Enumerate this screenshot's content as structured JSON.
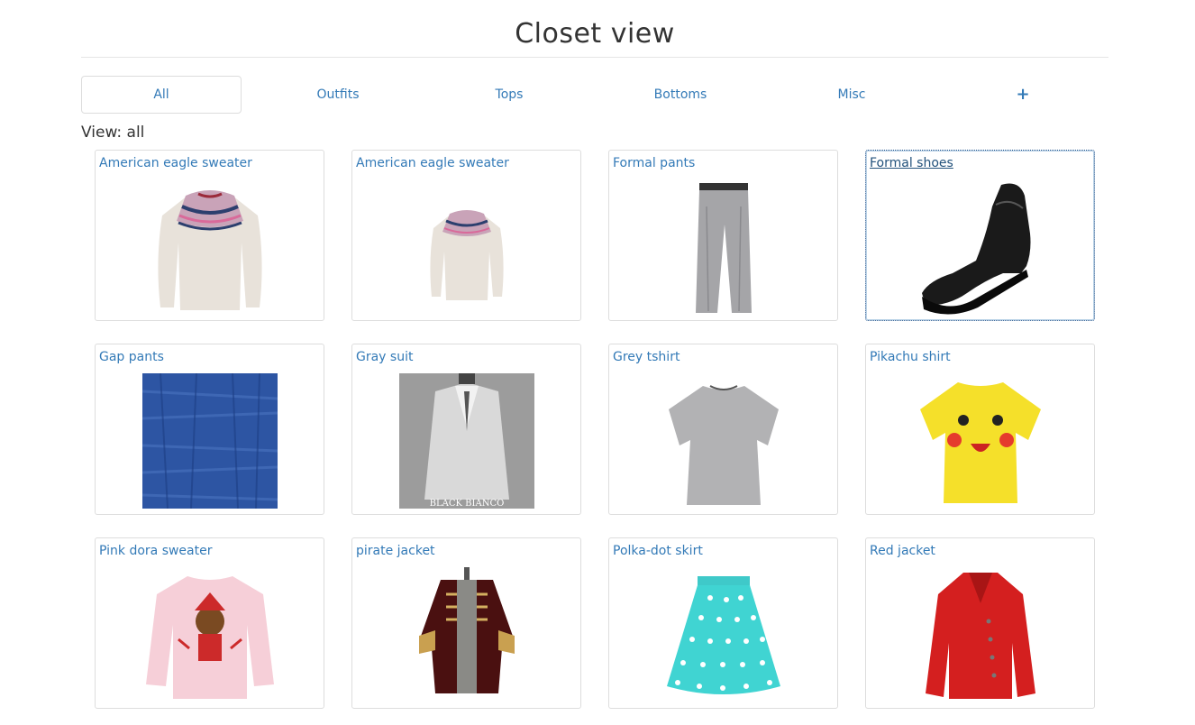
{
  "page": {
    "title": "Closet view",
    "view_label": "View: all"
  },
  "tabs": [
    {
      "label": "All"
    },
    {
      "label": "Outfits"
    },
    {
      "label": "Tops"
    },
    {
      "label": "Bottoms"
    },
    {
      "label": "Misc"
    },
    {
      "label": "+"
    }
  ],
  "items": [
    {
      "name": "American eagle sweater",
      "image": "patterned-sweater-image"
    },
    {
      "name": "American eagle sweater",
      "image": "patterned-sweater-image"
    },
    {
      "name": "Formal pants",
      "image": "gray-pants-image"
    },
    {
      "name": "Formal shoes",
      "image": "black-shoe-image"
    },
    {
      "name": "Gap pants",
      "image": "denim-fabric-image"
    },
    {
      "name": "Gray suit",
      "image": "gray-suit-image",
      "image_text": "BLACK BIANCO"
    },
    {
      "name": "Grey tshirt",
      "image": "gray-tshirt-image"
    },
    {
      "name": "Pikachu shirt",
      "image": "pikachu-shirt-image"
    },
    {
      "name": "Pink dora sweater",
      "image": "pink-sweater-image"
    },
    {
      "name": "pirate jacket",
      "image": "pirate-jacket-image"
    },
    {
      "name": "Polka-dot skirt",
      "image": "polka-skirt-image"
    },
    {
      "name": "Red jacket",
      "image": "red-jacket-image"
    }
  ],
  "colors": {
    "link": "#337ab7",
    "border": "#dddddd",
    "text": "#333333"
  }
}
